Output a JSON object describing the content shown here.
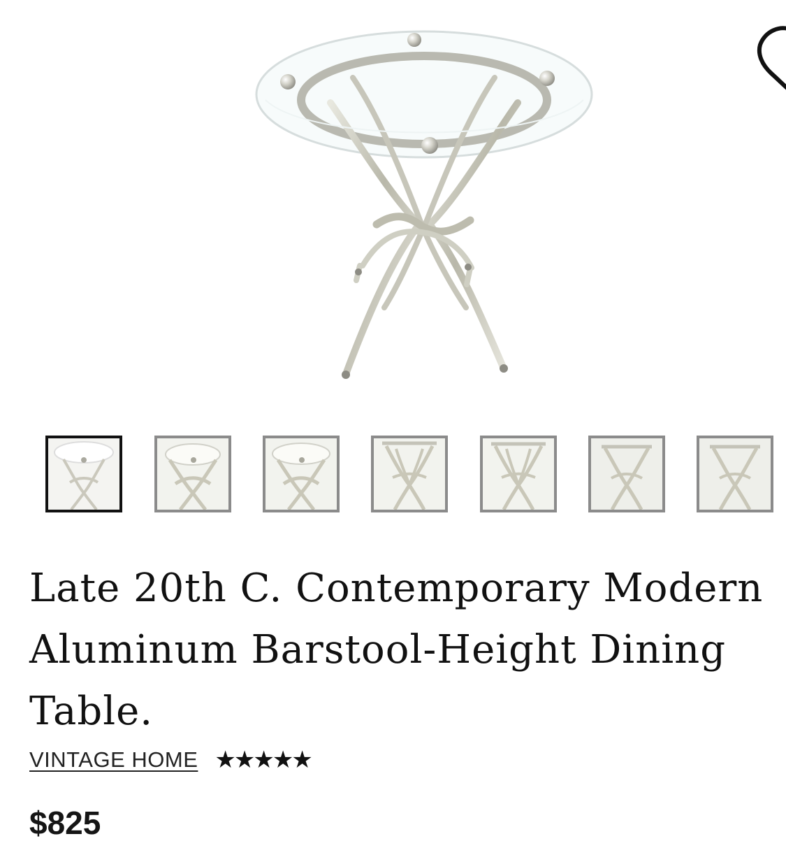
{
  "product": {
    "title_lines": [
      "Late 20th C. Contemporary Modern",
      "Aluminum Barstool-Height Dining",
      "Table."
    ],
    "seller": "VINTAGE HOME",
    "rating": "★★★★★",
    "price": "$825"
  },
  "gallery": {
    "hero_image": "glass-top-aluminum-dining-table",
    "favorite_icon": "heart-icon",
    "thumbnails": [
      {
        "name": "thumbnail-1",
        "selected": true
      },
      {
        "name": "thumbnail-2",
        "selected": false
      },
      {
        "name": "thumbnail-3",
        "selected": false
      },
      {
        "name": "thumbnail-4",
        "selected": false
      },
      {
        "name": "thumbnail-5",
        "selected": false
      },
      {
        "name": "thumbnail-6",
        "selected": false
      },
      {
        "name": "thumbnail-7",
        "selected": false
      }
    ]
  },
  "colors": {
    "accent": "#111111",
    "thumbnail_border": "#8b8b8b",
    "metal": "#c9c9bd"
  }
}
